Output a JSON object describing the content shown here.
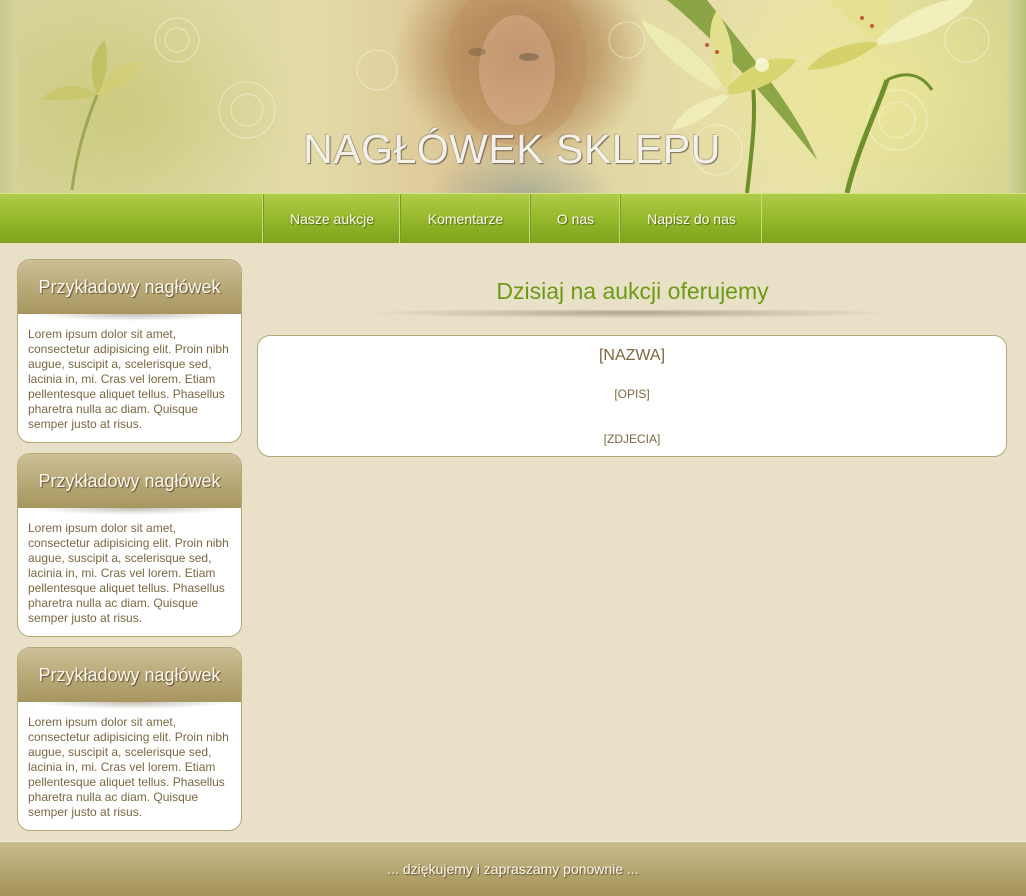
{
  "header": {
    "title": "NAGŁÓWEK SKLEPU"
  },
  "nav": {
    "items": [
      {
        "label": "Nasze aukcje"
      },
      {
        "label": "Komentarze"
      },
      {
        "label": "O nas"
      },
      {
        "label": "Napisz do nas"
      }
    ]
  },
  "sidebar": {
    "boxes": [
      {
        "title": "Przykładowy nagłówek",
        "text": "Lorem ipsum dolor sit amet, consectetur adipisicing elit. Proin nibh augue, suscipit a, scelerisque sed, lacinia in, mi. Cras vel lorem. Etiam pellentesque aliquet tellus. Phasellus pharetra nulla ac diam. Quisque semper justo at risus."
      },
      {
        "title": "Przykładowy nagłówek",
        "text": "Lorem ipsum dolor sit amet, consectetur adipisicing elit. Proin nibh augue, suscipit a, scelerisque sed, lacinia in, mi. Cras vel lorem. Etiam pellentesque aliquet tellus. Phasellus pharetra nulla ac diam. Quisque semper justo at risus."
      },
      {
        "title": "Przykładowy nagłówek",
        "text": "Lorem ipsum dolor sit amet, consectetur adipisicing elit. Proin nibh augue, suscipit a, scelerisque sed, lacinia in, mi. Cras vel lorem. Etiam pellentesque aliquet tellus. Phasellus pharetra nulla ac diam. Quisque semper justo at risus."
      }
    ]
  },
  "main": {
    "heading": "Dzisiaj na aukcji oferujemy",
    "panel": {
      "name": "[NAZWA]",
      "description": "[OPIS]",
      "photos": "[ZDJECIA]"
    }
  },
  "footer": {
    "text": "... dziękujemy i zapraszamy ponownie ..."
  },
  "colors": {
    "nav_green": "#98bb2e",
    "heading_green": "#6d9a14",
    "box_tan": "#b8a877",
    "page_bg": "#e8e1c8",
    "text_brown": "#7a6840"
  },
  "icons": [
    "lily-flower-illustration",
    "woman-portrait-illustration"
  ]
}
